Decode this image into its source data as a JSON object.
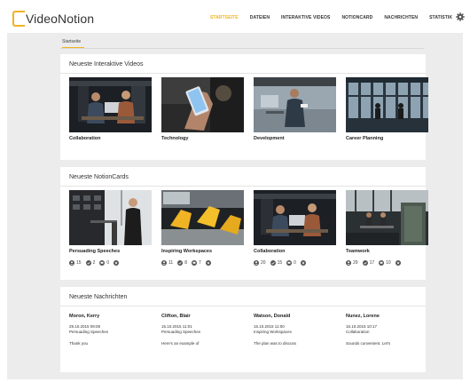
{
  "app": {
    "logo_text": "VideoNotion"
  },
  "nav": {
    "items": [
      {
        "label": "STARTSEITE",
        "active": true
      },
      {
        "label": "DATEIEN"
      },
      {
        "label": "INTERAKTIVE VIDEOS"
      },
      {
        "label": "NOTIONCARD"
      },
      {
        "label": "NACHRICHTEN"
      },
      {
        "label": "STATISTIK"
      }
    ],
    "settings_icon": "gear-icon"
  },
  "breadcrumb": {
    "label": "Startseite"
  },
  "videos": {
    "title": "Neueste Interaktive Videos",
    "items": [
      {
        "title": "Collaboration"
      },
      {
        "title": "Technology"
      },
      {
        "title": "Development"
      },
      {
        "title": "Career Planning"
      }
    ]
  },
  "notioncards": {
    "title": "Neueste NotionCards",
    "items": [
      {
        "title": "Persuading Speeches",
        "stats": [
          "15",
          "2",
          "0",
          ""
        ]
      },
      {
        "title": "Inspiring Workspaces",
        "stats": [
          "11",
          "8",
          "7",
          ""
        ]
      },
      {
        "title": "Collaboration",
        "stats": [
          "20",
          "15",
          "0",
          ""
        ]
      },
      {
        "title": "Teamwork",
        "stats": [
          "29",
          "17",
          "10",
          ""
        ]
      }
    ],
    "stat_icons": [
      "user-icon",
      "check-icon",
      "comment-icon",
      "star-icon"
    ]
  },
  "messages": {
    "title": "Neueste Nachrichten",
    "items": [
      {
        "name": "Moron, Kerry",
        "date": "29.10.2015 09:08",
        "topic": "Persuading Speeches",
        "text": "Thank you"
      },
      {
        "name": "Clifton, Blair",
        "date": "15.10.2015 11:01",
        "topic": "Persuading Speeches",
        "text": "Here's an example of"
      },
      {
        "name": "Watson, Donald",
        "date": "15.10.2015 11:00",
        "topic": "Inspiring Workspaces",
        "text": "The plan was to discuss"
      },
      {
        "name": "Nunez, Lorene",
        "date": "15.10.2015 10:17",
        "topic": "Collaboration",
        "text": "Sounds convenient. Let's"
      }
    ]
  },
  "colors": {
    "accent": "#f0b323",
    "background": "#ececec",
    "card": "#ffffff"
  }
}
